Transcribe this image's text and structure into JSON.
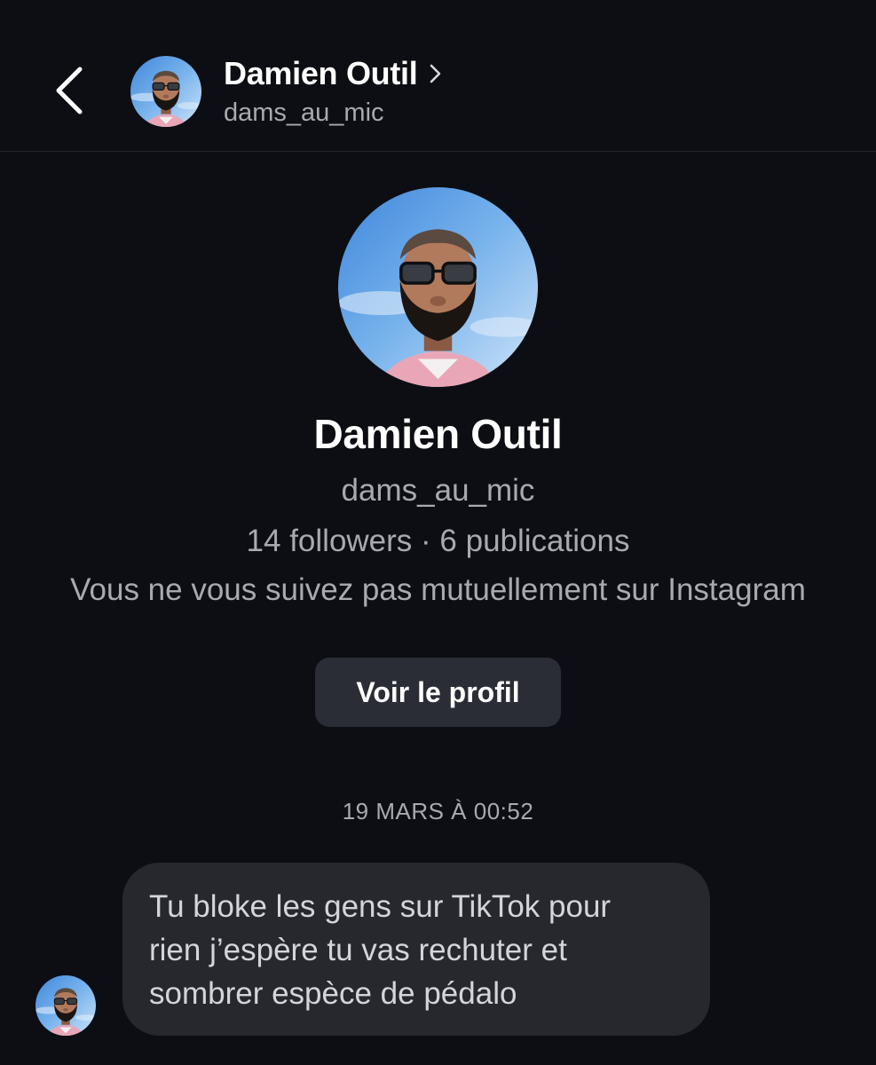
{
  "header": {
    "back_icon": "chevron-left-icon",
    "name": "Damien Outil",
    "chevron_icon": "chevron-right-icon",
    "username": "dams_au_mic"
  },
  "profile": {
    "name": "Damien Outil",
    "username": "dams_au_mic",
    "stats": "14 followers · 6 publications",
    "mutual": "Vous ne vous suivez pas mutuellement sur Instagram",
    "view_profile_label": "Voir le profil"
  },
  "conversation": {
    "timestamp": "19 MARS À 00:52",
    "messages": [
      {
        "lines": [
          "Tu bloke les gens sur TikTok pour",
          "rien j’espère tu vas rechuter et",
          "sombrer espèce de pédalo"
        ]
      }
    ]
  },
  "colors": {
    "background": "#0c0e13",
    "text_primary": "#ffffff",
    "text_secondary": "#a8aab1",
    "button_bg": "#2a2d35",
    "bubble_bg": "#26282e"
  }
}
